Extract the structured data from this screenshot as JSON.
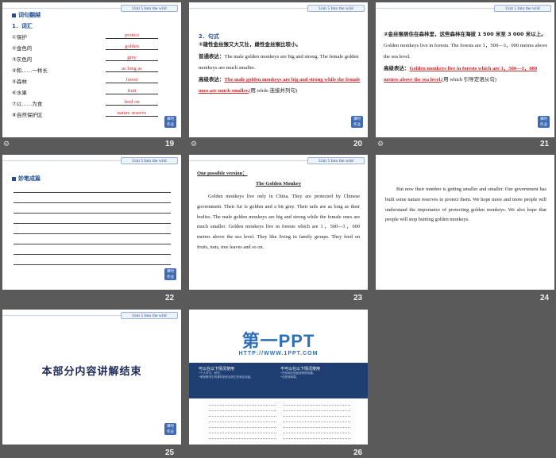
{
  "unit_tag": "Unit 5  Into the wild",
  "slide_badge": [
    "课时",
    "作业"
  ],
  "icons": {
    "corner": "gear-icon"
  },
  "slide19": {
    "number": "19",
    "title": "词句翻越",
    "subtitle": "1．词汇",
    "vocab": [
      {
        "zh": "①保护",
        "en": "protect"
      },
      {
        "zh": "②金色的",
        "en": "golden"
      },
      {
        "zh": "③灰色的",
        "en": "grey"
      },
      {
        "zh": "④和……一样长",
        "en": "as long as"
      },
      {
        "zh": "⑤森林",
        "en": "forest"
      },
      {
        "zh": "⑥水果",
        "en": "fruit"
      },
      {
        "zh": "⑦以……为食",
        "en": "feed on"
      },
      {
        "zh": "⑧自然保护区",
        "en": "nature reserve"
      }
    ]
  },
  "slide20": {
    "number": "20",
    "title": "2．句式",
    "s1_label": "①雄性金丝猴又大又壮，雌性金丝猴比较小。",
    "plain_label": "普通表达：",
    "plain_text": "The male golden monkeys are big and strong. The female golden monkeys are much smaller.",
    "adv_label": "高级表达：",
    "adv_text": "The male golden monkeys are big and strong while the female ones are much smaller.",
    "adv_note": "(用 while 连接并列句)"
  },
  "slide21": {
    "number": "21",
    "s2_label": "②金丝猴居住在森林里，这些森林在海拔 1 500 米至 3 000 米以上。",
    "plain_text": "Golden monkeys live in forests. The forests are 1，500—3，000 metres above the sea level.",
    "adv_label": "高级表达：",
    "adv_text": "Golden monkeys live in forests which are 1，500—3，000 metres above the sea level.",
    "adv_note": "(用 which 引导定语从句)"
  },
  "slide22": {
    "number": "22",
    "title": "妙笔成篇"
  },
  "slide23": {
    "number": "23",
    "version_label": "One possible version：",
    "essay_title": "The Golden Monkey",
    "essay": "Golden monkeys live only in China. They are protected by Chinese government. Their fur is golden and a bit grey. Their tails   are as long as their bodies. The male golden monkeys are big and strong while the female ones are much smaller. Golden monkeys live in forests which are 1，500—3，000 metres above the sea level. They like living in family groups. They feed on fruits, nuts, tree leaves and so on."
  },
  "slide24": {
    "number": "24",
    "essay": "But now their number is getting smaller and smaller. Our government has built some nature reserves to protect them. We hope more and more people will understand the importance of protecting golden monkeys. We also hope that people will stop hunting golden monkeys."
  },
  "slide25": {
    "number": "25",
    "text": "本部分内容讲解结束"
  },
  "slide26": {
    "number": "26",
    "logo": "第一PPT",
    "url": "HTTP://WWW.1PPT.COM",
    "left_head": "可以在以下情况使用",
    "right_head": "不可以在以下情况使用",
    "left_small": [
      "•个人学习、研究。",
      "•教育教学中的课件制作及其它非商业用途。"
    ],
    "right_small": [
      "•任何商业用途或网络传播。",
      "•出售或转载。"
    ]
  },
  "colors": {
    "background": "#5a5a5a",
    "accent": "#1e4f9e",
    "answer_red": "#d4262a",
    "band": "#1f3f73"
  }
}
